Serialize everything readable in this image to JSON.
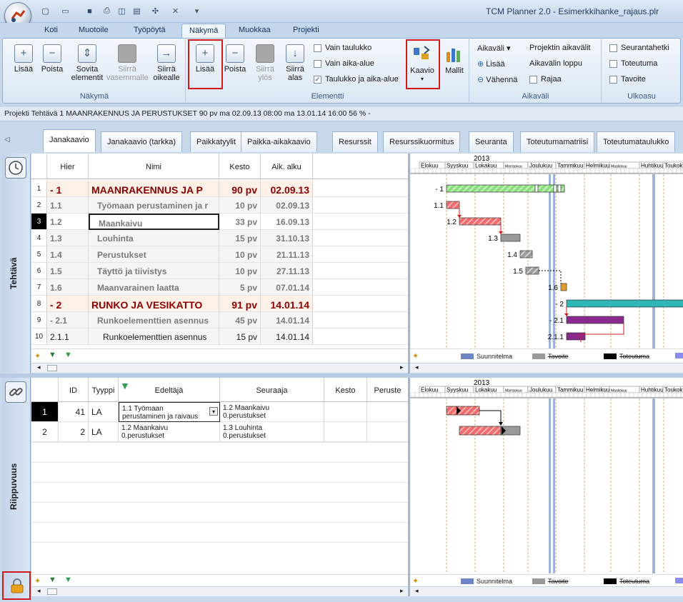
{
  "window": {
    "title": "TCM Planner 2.0 - Esimerkkihanke_rajaus.plr"
  },
  "ribbon_tabs": [
    {
      "label": "Koti",
      "active": false
    },
    {
      "label": "Muotoile",
      "active": false
    },
    {
      "label": "Työpöytä",
      "active": false
    },
    {
      "label": "Näkymä",
      "active": true
    },
    {
      "label": "Muokkaa",
      "active": false
    },
    {
      "label": "Projekti",
      "active": false
    }
  ],
  "groups": {
    "nakyma": {
      "label": "Näkymä",
      "buttons": [
        {
          "label": "Lisää",
          "icon": "add-icon",
          "enabled": true
        },
        {
          "label": "Poista",
          "icon": "remove-icon",
          "enabled": true
        },
        {
          "label": "Sovita elementit",
          "icon": "fit-icon",
          "enabled": true
        },
        {
          "label": "Siirrä vasemmalle",
          "icon": "move-left-icon",
          "enabled": false
        },
        {
          "label": "Siirrä oikealle",
          "icon": "move-right-icon",
          "enabled": true
        }
      ]
    },
    "elementti": {
      "label": "Elementti",
      "buttons": [
        {
          "label": "Lisää",
          "icon": "add-element-icon",
          "enabled": true
        },
        {
          "label": "Poista",
          "icon": "remove-element-icon",
          "enabled": true
        },
        {
          "label": "Siirrä ylös",
          "icon": "move-up-icon",
          "enabled": false
        },
        {
          "label": "Siirrä alas",
          "icon": "move-down-icon",
          "enabled": true
        }
      ],
      "checks": [
        {
          "label": "Vain taulukko",
          "checked": false
        },
        {
          "label": "Vain aika-alue",
          "checked": false
        },
        {
          "label": "Taulukko ja aika-alue",
          "checked": true
        }
      ],
      "kaavio": "Kaavio",
      "mallit": "Mallit"
    },
    "aikavali": {
      "label": "Aikaväli",
      "items": [
        "Aikaväli",
        "Projektin aikavälit",
        "Lisää",
        "Aikavälin loppu",
        "Vähennä",
        "Rajaa"
      ]
    },
    "ulkoasu": {
      "label": "Ulkoasu",
      "checks": [
        "Seurantahetki",
        "Toteutuma",
        "Tavoite"
      ]
    }
  },
  "project_line": "Projekti  Tehtävä 1  MAANRAKENNUS JA PERUSTUKSET  90 pv  ma 02.09.13 08:00  ma 13.01.14 16:00  56 %   -",
  "view_tabs": [
    "Janakaavio",
    "Janakaavio (tarkka)",
    "Paikkatyylit",
    "Paikka-aikakaavio",
    "Resurssit",
    "Resurssikuormitus",
    "Seuranta",
    "Toteutumamatriisi",
    "Toteutumataulukko"
  ],
  "tasks": {
    "side_label": "Tehtävä",
    "headers": {
      "hier": "Hier",
      "name": "Nimi",
      "kesto": "Kesto",
      "alku": "Aik. alku"
    },
    "rows": [
      {
        "n": "1",
        "hier": "- 1",
        "name": "MAANRAKENNUS JA P",
        "kesto": "90 pv",
        "alku": "02.09.13",
        "level": 0
      },
      {
        "n": "2",
        "hier": "1.1",
        "name": "Työmaan perustaminen ja r",
        "kesto": "10 pv",
        "alku": "02.09.13",
        "level": 1
      },
      {
        "n": "3",
        "hier": "1.2",
        "name": "Maankaivu",
        "kesto": "33 pv",
        "alku": "16.09.13",
        "level": 1
      },
      {
        "n": "4",
        "hier": "1.3",
        "name": "Louhinta",
        "kesto": "15 pv",
        "alku": "31.10.13",
        "level": 1
      },
      {
        "n": "5",
        "hier": "1.4",
        "name": "Perustukset",
        "kesto": "10 pv",
        "alku": "21.11.13",
        "level": 1
      },
      {
        "n": "6",
        "hier": "1.5",
        "name": "Täyttö ja tiivistys",
        "kesto": "10 pv",
        "alku": "27.11.13",
        "level": 1
      },
      {
        "n": "7",
        "hier": "1.6",
        "name": "Maanvarainen laatta",
        "kesto": "5 pv",
        "alku": "07.01.14",
        "level": 1
      },
      {
        "n": "8",
        "hier": "- 2",
        "name": "RUNKO JA VESIKATTO",
        "kesto": "91 pv",
        "alku": "14.01.14",
        "level": 0
      },
      {
        "n": "9",
        "hier": "- 2.1",
        "name": "Runkoelementtien asennus",
        "kesto": "45 pv",
        "alku": "14.01.14",
        "level": 1
      },
      {
        "n": "10",
        "hier": "2.1.1",
        "name": "Runkoelementtien asennus",
        "kesto": "15 pv",
        "alku": "14.01.14",
        "level": 2
      }
    ]
  },
  "deps": {
    "side_label": "Riippuvuus",
    "headers": {
      "id": "ID",
      "tyyppi": "Tyyppi",
      "edeltaja": "Edeltäjä",
      "seuraaja": "Seuraaja",
      "kesto": "Kesto",
      "peruste": "Peruste"
    },
    "rows": [
      {
        "n": "1",
        "id": "41",
        "tyyppi": "LA",
        "edeltaja1": "1.1  Työmaan",
        "edeltaja2": "perustaminen ja raivaus",
        "seuraaja1": "1.2  Maankaivu",
        "seuraaja2": "0.perustukset"
      },
      {
        "n": "2",
        "id": "2",
        "tyyppi": "LA",
        "edeltaja1": "1.2  Maankaivu",
        "edeltaja2": "0.perustukset",
        "seuraaja1": "1.3  Louhinta",
        "seuraaja2": "0.perustukset"
      }
    ]
  },
  "timeline": {
    "year": "2013",
    "months": [
      "Elokuu",
      "Syyskuu",
      "Lokakuu",
      "Marraskuu",
      "Joulukuu",
      "Tammikuu",
      "Helmikuu",
      "Maaliskuu",
      "Huhtikuu",
      "Toukokuu"
    ]
  },
  "gantt_labels": [
    "- 1",
    "1.1",
    "1.2",
    "1.3",
    "1.4",
    "1.5",
    "1.6",
    "- 2",
    "- 2.1",
    "2.1.1"
  ],
  "legend": {
    "plan": "Suunnitelma",
    "target": "Tavoite",
    "actual": "Toteutuma"
  },
  "colors": {
    "planned_red": "#f06b6b",
    "summary_green": "#88e07a",
    "summary_teal": "#2fb6b6",
    "purple": "#8a2a8e",
    "gray": "#9a9a9a",
    "highlight_red": "#d01a1a"
  }
}
